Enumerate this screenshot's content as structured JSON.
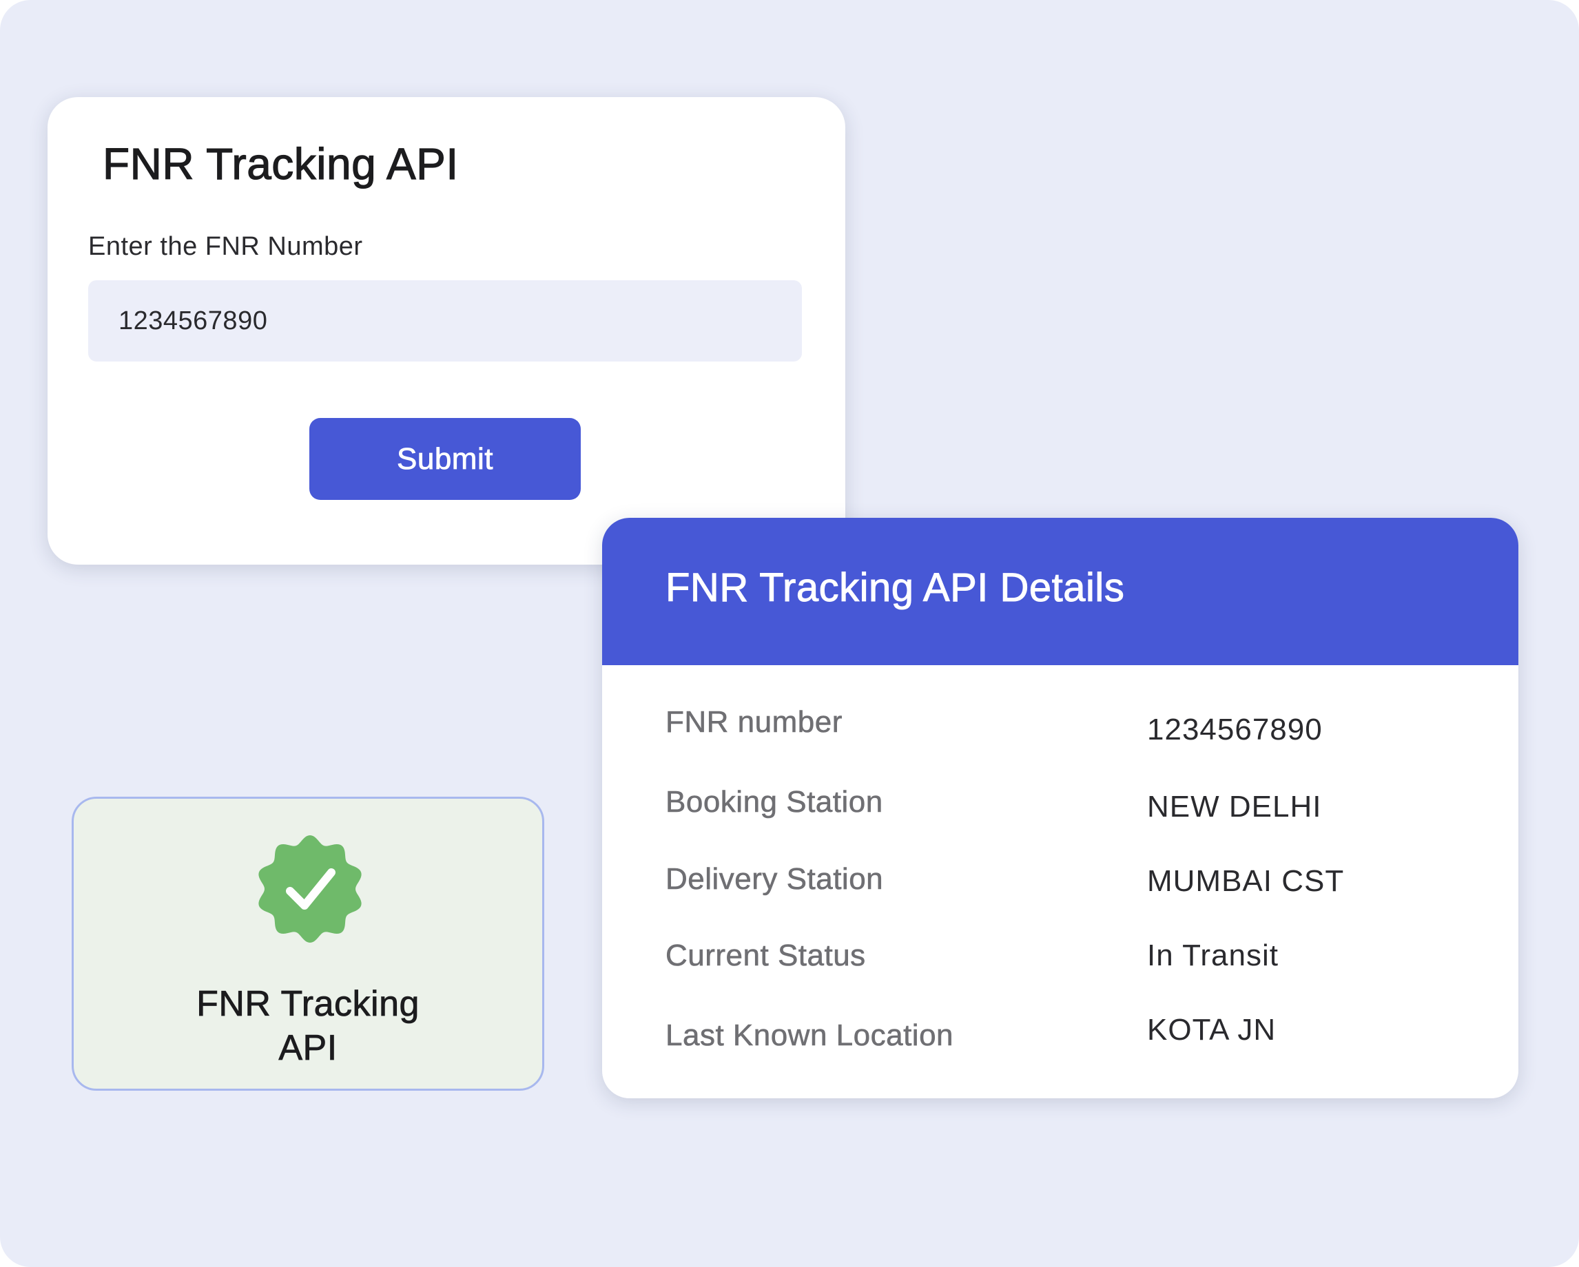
{
  "form": {
    "title": "FNR Tracking API",
    "field_label": "Enter the FNR Number",
    "fnr_value": "1234567890",
    "submit_label": "Submit"
  },
  "badge": {
    "icon": "verified-check-icon",
    "label_line1": "FNR Tracking",
    "label_line2": "API"
  },
  "details": {
    "title": "FNR Tracking API Details",
    "rows": [
      {
        "label": "FNR number",
        "value": "1234567890"
      },
      {
        "label": "Booking Station",
        "value": "NEW DELHI"
      },
      {
        "label": "Delivery Station",
        "value": "MUMBAI CST"
      },
      {
        "label": "Current Status",
        "value": "In Transit"
      },
      {
        "label": "Last Known Location",
        "value": "KOTA JN"
      }
    ]
  },
  "colors": {
    "background": "#e9ecf8",
    "accent": "#4758d6",
    "input_bg": "#eceef9",
    "badge_bg": "#ecf2ea",
    "badge_border": "#a8b8ee",
    "verified_green": "#6fba6a"
  }
}
